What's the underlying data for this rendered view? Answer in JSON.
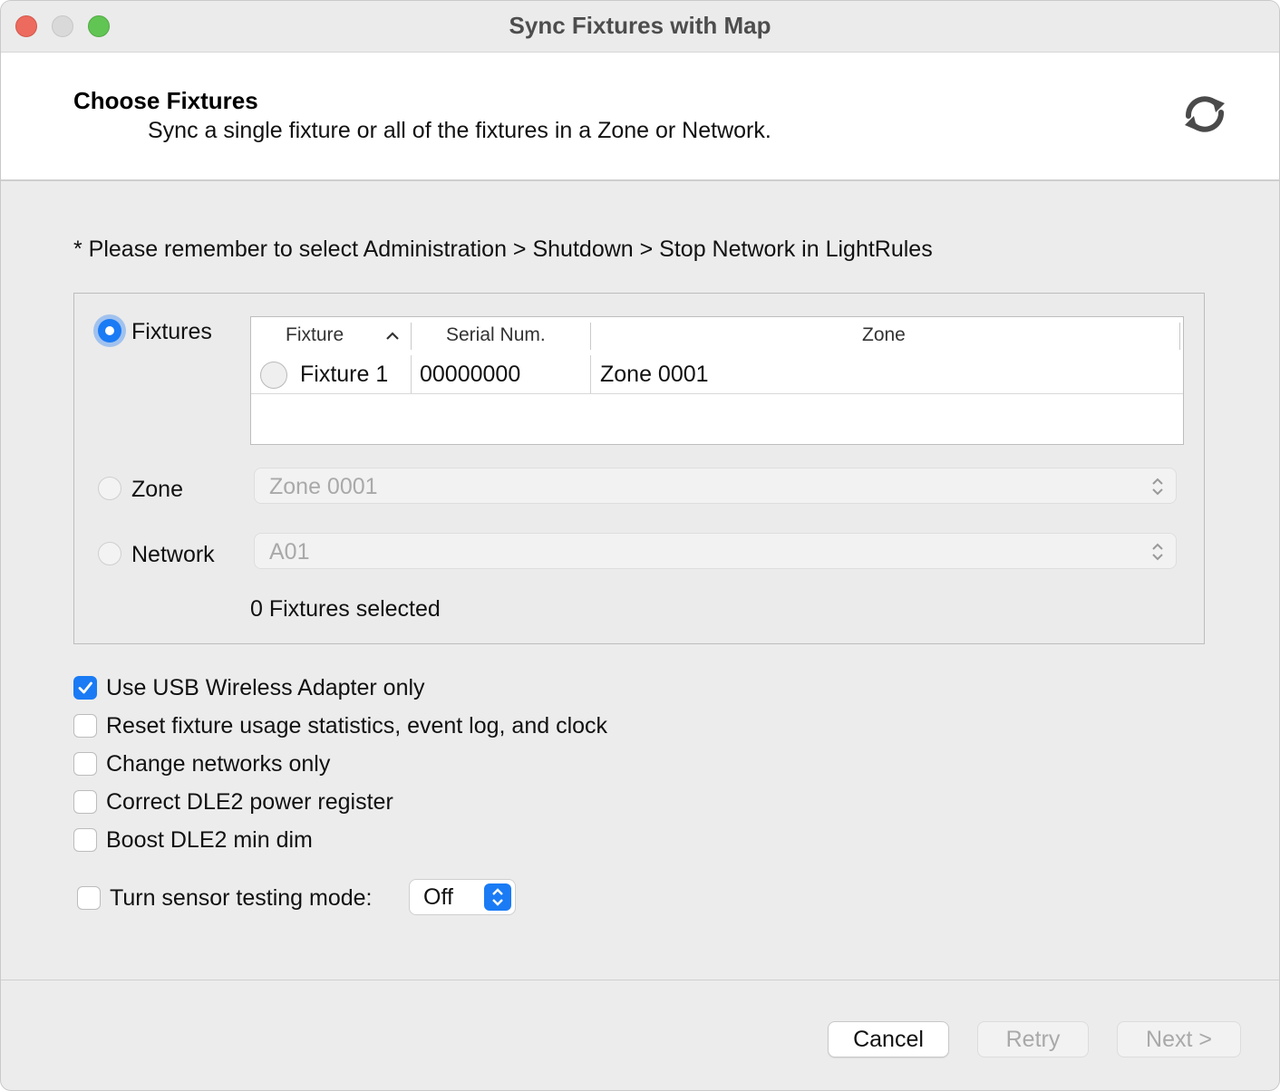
{
  "window": {
    "title": "Sync Fixtures with Map"
  },
  "header": {
    "title": "Choose Fixtures",
    "subtitle": "Sync a single fixture or all of the fixtures in a Zone or Network."
  },
  "note": "* Please remember to select Administration > Shutdown > Stop Network in LightRules",
  "scope": {
    "fixtures_label": "Fixtures",
    "zone_label": "Zone",
    "network_label": "Network",
    "selected": "Fixtures",
    "zone_value": "Zone 0001",
    "network_value": "A01",
    "count_text": "0 Fixtures selected"
  },
  "table": {
    "columns": [
      "Fixture",
      "Serial Num.",
      "Zone"
    ],
    "rows": [
      {
        "fixture": "Fixture 1",
        "serial": "00000000",
        "zone": "Zone 0001",
        "selected": false
      }
    ]
  },
  "options": [
    {
      "label": "Use USB Wireless Adapter only",
      "checked": true
    },
    {
      "label": "Reset fixture usage statistics, event log, and clock",
      "checked": false
    },
    {
      "label": "Change networks only",
      "checked": false
    },
    {
      "label": "Correct DLE2 power register",
      "checked": false
    },
    {
      "label": "Boost DLE2 min dim",
      "checked": false
    }
  ],
  "sensor_mode": {
    "label": "Turn sensor testing mode:",
    "checked": false,
    "value": "Off"
  },
  "buttons": {
    "cancel": "Cancel",
    "retry": "Retry",
    "next": "Next >"
  },
  "colors": {
    "accent": "#1a7bf5",
    "close": "#ed6a5e",
    "minimize": "#d9d9d9",
    "maximize": "#61c554"
  },
  "icons": {
    "sync": "sync-arrows-icon",
    "sort": "chevron-up-icon",
    "popup": "up-down-chevron-icon"
  }
}
